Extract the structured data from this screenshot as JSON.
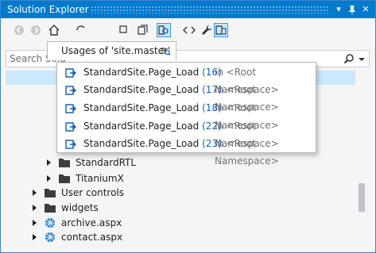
{
  "window": {
    "title": "Solution Explorer",
    "pin_icon": "pin-icon",
    "dropdown_icon": "dropdown-arrow-icon",
    "close_icon": "close-icon"
  },
  "search": {
    "placeholder": "Search Solution Explorer (Ctrl+;)",
    "visible_text": "Search Solu"
  },
  "popup": {
    "title": "Usages of 'site.master'",
    "items": [
      {
        "name": "StandardSite.Page_Load",
        "line": "(16)",
        "location": "in <Root Namespace>"
      },
      {
        "name": "StandardSite.Page_Load",
        "line": "(17)",
        "location": "in <Root Namespace>"
      },
      {
        "name": "StandardSite.Page_Load",
        "line": "(18)",
        "location": "in <Root Namespace>"
      },
      {
        "name": "StandardSite.Page_Load",
        "line": "(22)",
        "location": "in <Root Namespace>"
      },
      {
        "name": "StandardSite.Page_Load",
        "line": "(23)",
        "location": "in <Root Namespace>"
      }
    ]
  },
  "tree": {
    "nodes": [
      {
        "label": "StandardRTL",
        "icon": "folder-icon"
      },
      {
        "label": "TitaniumX",
        "icon": "folder-icon"
      },
      {
        "label": "User controls",
        "icon": "folder-icon"
      },
      {
        "label": "widgets",
        "icon": "folder-icon"
      },
      {
        "label": "archive.aspx",
        "icon": "aspx-file-icon"
      },
      {
        "label": "contact.aspx",
        "icon": "aspx-file-icon"
      }
    ]
  },
  "colors": {
    "titlebar": "#007acc",
    "selection": "#cce8ff",
    "line_number": "#1b5fad",
    "location_text": "#717171"
  }
}
